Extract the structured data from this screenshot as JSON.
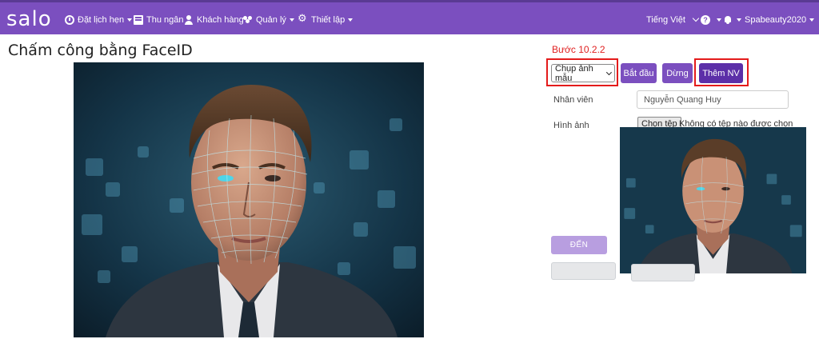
{
  "navbar": {
    "brand": "salo",
    "items": [
      {
        "label": "Đặt lịch hẹn",
        "icon": "clock-icon"
      },
      {
        "label": "Thu ngân",
        "icon": "cash-register-icon"
      },
      {
        "label": "Khách hàng",
        "icon": "user-icon"
      },
      {
        "label": "Quản lý",
        "icon": "users-icon"
      },
      {
        "label": "Thiết lập",
        "icon": "cogs-icon"
      }
    ],
    "language": "Tiếng Việt",
    "help_icon": "?",
    "account": "Spabeauty2020",
    "colors": {
      "bar": "#7b4fbf"
    }
  },
  "page": {
    "title": "Chấm công bằng FaceID"
  },
  "step": "Bước 10.2.2",
  "controls": {
    "mode_select_value": "Chụp ảnh mẫu",
    "start_label": "Bắt đầu",
    "stop_label": "Dừng",
    "add_employee_label": "Thêm NV"
  },
  "form": {
    "employee_label": "Nhân viên",
    "employee_value": "Nguyễn Quang Huy",
    "image_label": "Hình ảnh",
    "file_button": "Chọn tệp",
    "file_status": "Không có tệp nào được chọn",
    "submit_label": "ĐẾN"
  },
  "colors": {
    "accent": "#7b4fbf",
    "highlight": "#e41b1b",
    "step_text": "#e02020"
  }
}
